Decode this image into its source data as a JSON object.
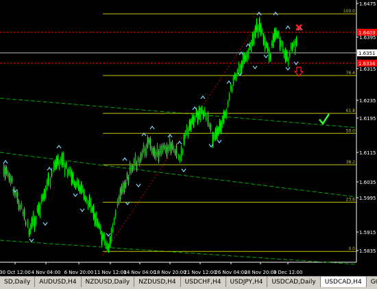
{
  "colors": {
    "background": "#000000",
    "bull": "#00ff00",
    "bear": "#00c800",
    "fib": "#c8c800",
    "red_level": "#ff0000",
    "trend": "#00aa00",
    "text": "#ffffff"
  },
  "chart_data": {
    "type": "candlestick",
    "y_ticks": [
      "1.6475",
      "1.6395",
      "1.6315",
      "1.6235",
      "1.6195",
      "1.6115",
      "1.6035",
      "1.5995",
      "1.5915",
      "1.5835"
    ],
    "x_ticks": [
      "30 Oct 12:00",
      "4 Nov 04:00",
      "6 Nov 20:00",
      "11 Nov 12:00",
      "14 Nov 04:00",
      "18 Nov 20:00",
      "21 Nov 12:00",
      "26 Nov 04:00",
      "28 Nov 20:00",
      "3 Dec 12:00"
    ],
    "current_price": "1.6351",
    "red_levels": [
      "1.6403",
      "1.6334"
    ],
    "fib_levels": [
      {
        "label": "100.0",
        "price": 1.6468
      },
      {
        "label": "76.4",
        "price": 1.6305
      },
      {
        "label": "61.8",
        "price": 1.6205
      },
      {
        "label": "50.0",
        "price": 1.6152
      },
      {
        "label": "38.2",
        "price": 1.6069
      },
      {
        "label": "23.6",
        "price": 1.597
      },
      {
        "label": "0.0",
        "price": 1.584
      }
    ],
    "ylim": [
      1.5815,
      1.649
    ],
    "grid": false
  },
  "tabs": [
    "SD,Daily",
    "AUDUSD,H4",
    "NZDUSD,Daily",
    "NZDUSD,H4",
    "USDCHF,H4",
    "USDJPY,H4",
    "USDCAD,Daily",
    "USDCAD,H4",
    "GOLD,Daily",
    "GOLD,H4"
  ],
  "active_tab": 7
}
